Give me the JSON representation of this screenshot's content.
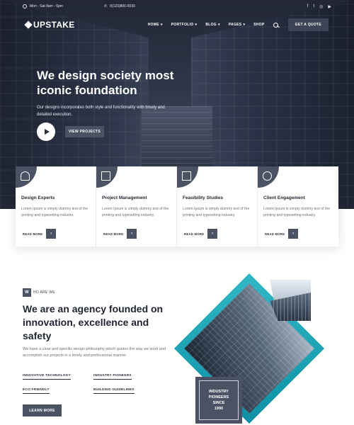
{
  "topbar": {
    "hours": "Mon - Sat 8am - 6pm",
    "phone": "0(123)800-0030",
    "social": [
      "f",
      "t",
      "ig",
      "yt"
    ]
  },
  "nav": {
    "logo": "UPSTAKE",
    "items": [
      "HOME",
      "PORTFOLIO",
      "BLOG",
      "PAGES",
      "SHOP"
    ],
    "quote_button": "GET A QUOTE"
  },
  "hero": {
    "title": "We design society most iconic foundation",
    "text": "Our designs incorporates both style and functionality with timely and detailed execution.",
    "view_button": "VIEW PROJECTS"
  },
  "services": [
    {
      "title": "Design Experts",
      "text": "Lorem Ipsum is simply dummy text of the printing and typesetting industry.",
      "more": "READ MORE",
      "icon": "compass-icon"
    },
    {
      "title": "Project Management",
      "text": "Lorem Ipsum is simply dummy text of the printing and typesetting industry.",
      "more": "READ MORE",
      "icon": "document-icon"
    },
    {
      "title": "Feasibility Studies",
      "text": "Lorem Ipsum is simply dummy text of the printing and typesetting industry.",
      "more": "READ MORE",
      "icon": "blueprint-icon"
    },
    {
      "title": "Client Engagement",
      "text": "Lorem Ipsum is simply dummy text of the printing and typesetting industry.",
      "more": "READ MORE",
      "icon": "handshake-icon"
    }
  ],
  "about": {
    "badge_letter": "W",
    "kicker": "HO ARE WE",
    "title": "We are an agency founded on innovation, excellence and safety",
    "text": "We have a clear and specific design philosophy which guides the way we work and accomplish our projects in a timely and professional manner.",
    "features": [
      "INNOVATIVE TECHNOLOGY",
      "INDUSTRY PIONEERS",
      "ECO FRIENDLY",
      "BUILDING GUIDELINES"
    ],
    "learn_button": "LEARN MORE",
    "industry_line1": "INDUSTRY",
    "industry_line2": "PIONEERS",
    "industry_line3": "SINCE",
    "industry_year": "1990"
  },
  "colors": {
    "accent": "#4a5264",
    "teal": "#1aa5b8"
  }
}
